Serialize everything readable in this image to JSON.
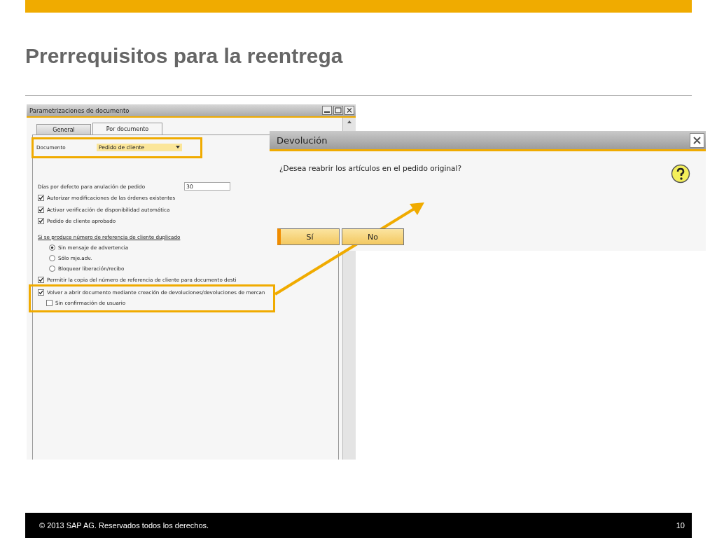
{
  "slide": {
    "title": "Prerrequisitos para la reentrega",
    "footer": {
      "copyright": "© 2013 SAP AG. Reservados todos los derechos.",
      "page": "10"
    }
  },
  "settings_window": {
    "title": "Parametrizaciones de documento",
    "tabs": [
      {
        "label": "General",
        "selected": false
      },
      {
        "label": "Por documento",
        "selected": true
      }
    ],
    "document_field": {
      "label": "Documento",
      "value": "Pedido de cliente",
      "highlighted": true
    },
    "days_field": {
      "label": "Días por defecto para anulación de pedido",
      "value": "30"
    },
    "options": [
      {
        "label": "Autorizar modificaciones de las órdenes existentes",
        "checked": true
      },
      {
        "label": "Activar verificación de disponibilidad automática",
        "checked": true
      },
      {
        "label": "Pedido de cliente aprobado",
        "checked": true
      }
    ],
    "duplicate_reference": {
      "heading": "Si se produce número de referencia de cliente duplicado",
      "choices": [
        {
          "label": "Sin mensaje de advertencia",
          "selected": true
        },
        {
          "label": "Sólo mje.adv.",
          "selected": false
        },
        {
          "label": "Bloquear liberación/recibo",
          "selected": false
        }
      ]
    },
    "copy_option": {
      "label": "Permitir la copia del número de referencia de cliente para documento desti",
      "checked": true
    },
    "reopen_option": {
      "label": "Volver a abrir documento mediante creación de devoluciones/devoluciones de mercan",
      "checked": true,
      "highlighted": true,
      "children": [
        {
          "label": "Sin confirmación de usuario",
          "checked": false
        }
      ]
    }
  },
  "dialog": {
    "title": "Devolución",
    "message": "¿Desea reabrir los artículos en el pedido original?",
    "buttons": [
      {
        "label": "Sí",
        "focused": true
      },
      {
        "label": "No",
        "focused": false
      }
    ]
  }
}
